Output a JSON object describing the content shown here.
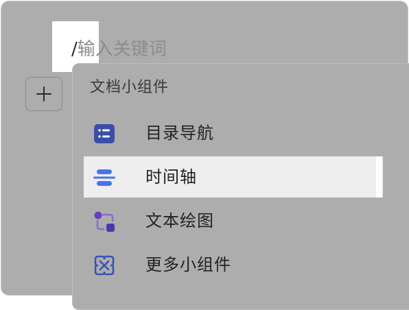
{
  "command": {
    "slash": "/",
    "placeholder": "输入关键词"
  },
  "add_button": {
    "icon": "plus-icon"
  },
  "menu": {
    "section_title": "文档小组件",
    "items": [
      {
        "label": "目录导航",
        "icon": "toc-list-icon",
        "color": "#3b4fa8"
      },
      {
        "label": "时间轴",
        "icon": "timeline-icon",
        "color": "#4a72e8",
        "active": true
      },
      {
        "label": "文本绘图",
        "icon": "text-diagram-icon",
        "color": "#6a3fbf"
      },
      {
        "label": "更多小组件",
        "icon": "more-widgets-icon",
        "color": "#3553b8"
      }
    ]
  },
  "colors": {
    "overlay": "#adadad",
    "highlight": "#eeeeee"
  }
}
